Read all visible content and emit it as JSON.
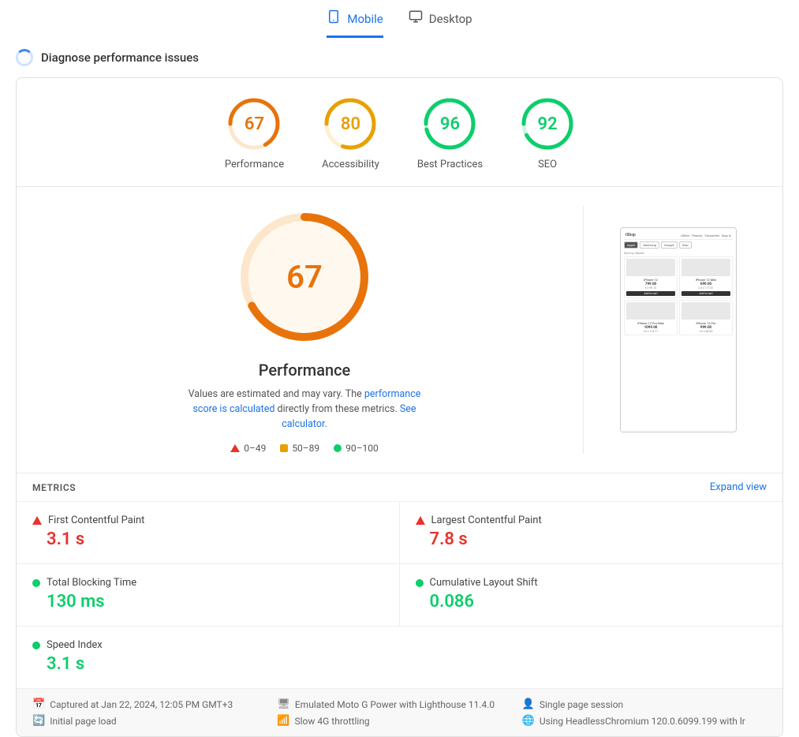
{
  "tabs": {
    "mobile": {
      "label": "Mobile",
      "active": true
    },
    "desktop": {
      "label": "Desktop",
      "active": false
    }
  },
  "diagnose": {
    "spinner": true,
    "label": "Diagnose performance issues"
  },
  "scores": [
    {
      "id": "performance",
      "value": 67,
      "label": "Performance",
      "color": "#e8730a",
      "track": "#fde7cc",
      "green": false
    },
    {
      "id": "accessibility",
      "value": 80,
      "label": "Accessibility",
      "color": "#e8a000",
      "track": "#fdf0cc",
      "green": false
    },
    {
      "id": "best-practices",
      "value": 96,
      "label": "Best Practices",
      "color": "#0cce6b",
      "track": "#ccf5e0",
      "green": true
    },
    {
      "id": "seo",
      "value": 92,
      "label": "SEO",
      "color": "#0cce6b",
      "track": "#ccf5e0",
      "green": true
    }
  ],
  "performance_detail": {
    "score": 67,
    "title": "Performance",
    "description_text": "Values are estimated and may vary. The ",
    "description_link": "performance score is calculated",
    "description_mid": " directly from these metrics. ",
    "calculator_link": "See calculator.",
    "legend": [
      {
        "type": "triangle",
        "color": "#e8322c",
        "range": "0–49"
      },
      {
        "type": "square",
        "color": "#e8a000",
        "range": "50–89"
      },
      {
        "type": "circle",
        "color": "#0cce6b",
        "range": "90–100"
      }
    ]
  },
  "metrics_header": {
    "label": "METRICS",
    "expand": "Expand view"
  },
  "metrics": [
    {
      "name": "First Contentful Paint",
      "value": "3.1 s",
      "indicator": "red-triangle"
    },
    {
      "name": "Largest Contentful Paint",
      "value": "7.8 s",
      "indicator": "red-triangle"
    },
    {
      "name": "Total Blocking Time",
      "value": "130 ms",
      "indicator": "green-circle"
    },
    {
      "name": "Cumulative Layout Shift",
      "value": "0.086",
      "indicator": "green-circle"
    },
    {
      "name": "Speed Index",
      "value": "3.1 s",
      "indicator": "green-circle"
    }
  ],
  "footer": {
    "captured": "Captured at Jan 22, 2024, 12:05 PM GMT+3",
    "initial": "Initial page load",
    "emulated": "Emulated Moto G Power with Lighthouse 11.4.0",
    "throttling": "Slow 4G throttling",
    "session": "Single page session",
    "browser": "Using HeadlessChromium 120.0.6099.199 with lr"
  },
  "phone_mockup": {
    "logo": "iShop",
    "nav": [
      "Offers",
      "Phones",
      "Favourites",
      "Sign in"
    ],
    "tabs": [
      "Apple",
      "Samsung",
      "Google",
      "Chip"
    ],
    "products": [
      {
        "name": "iPhone 12",
        "price": "799.00",
        "sub": "x 0 99.10"
      },
      {
        "name": "iPhone 12 Mini",
        "price": "699.00",
        "sub": "x 0 x 177.81"
      },
      {
        "name": "iPhone 12 Pro Max",
        "price": "1099.00",
        "sub": "x 0 x 125.71"
      },
      {
        "name": "iPhone 12 Pro",
        "price": "999.00",
        "sub": "x 0 x 88.60"
      }
    ]
  }
}
